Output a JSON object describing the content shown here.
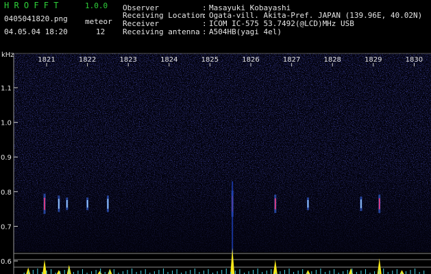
{
  "app": {
    "title": "H R O F F T",
    "version": "1.0.0"
  },
  "file_name": "0405041820.png",
  "meteor_label": "meteor",
  "meteor_count": "12",
  "date_time": "04.05.04 18:20",
  "info": [
    {
      "key": "Observer",
      "value": "Masayuki Kobayashi"
    },
    {
      "key": "Receiving Location",
      "value": "Ogata-vill. Akita-Pref. JAPAN (139.96E, 40.02N)"
    },
    {
      "key": "Receiver",
      "value": "ICOM IC-575 53.7492(@LCD)MHz USB"
    },
    {
      "key": "Receiving antenna",
      "value": "A504HB(yagi 4el)"
    }
  ],
  "separator": ":",
  "chart_data": {
    "type": "heatmap",
    "ylabel": "kHz",
    "x_ticks": [
      "1821",
      "1822",
      "1823",
      "1824",
      "1825",
      "1826",
      "1827",
      "1828",
      "1829",
      "1830"
    ],
    "y_ticks": [
      "1.1",
      "1.0",
      "0.9",
      "0.8",
      "0.7",
      "0.6"
    ],
    "xlim": [
      1820.5,
      1830.5
    ],
    "ylim": [
      0.58,
      1.18
    ],
    "meteor_echoes": [
      {
        "minute": 1820.95,
        "freq": 0.765,
        "strength": 0.7
      },
      {
        "minute": 1821.3,
        "freq": 0.765,
        "strength": 0.5
      },
      {
        "minute": 1821.5,
        "freq": 0.765,
        "strength": 0.3
      },
      {
        "minute": 1822.0,
        "freq": 0.765,
        "strength": 0.3
      },
      {
        "minute": 1822.5,
        "freq": 0.765,
        "strength": 0.5
      },
      {
        "minute": 1825.55,
        "freq": 0.765,
        "strength": 1.0
      },
      {
        "minute": 1826.6,
        "freq": 0.765,
        "strength": 0.6
      },
      {
        "minute": 1827.4,
        "freq": 0.765,
        "strength": 0.3
      },
      {
        "minute": 1828.7,
        "freq": 0.765,
        "strength": 0.4
      },
      {
        "minute": 1829.15,
        "freq": 0.765,
        "strength": 0.6
      }
    ],
    "bottom_peaks": [
      {
        "minute": 1820.55,
        "value": 0.25
      },
      {
        "minute": 1820.95,
        "value": 0.55
      },
      {
        "minute": 1821.3,
        "value": 0.15
      },
      {
        "minute": 1821.55,
        "value": 0.35
      },
      {
        "minute": 1822.3,
        "value": 0.12
      },
      {
        "minute": 1822.55,
        "value": 0.2
      },
      {
        "minute": 1825.55,
        "value": 1.0
      },
      {
        "minute": 1826.6,
        "value": 0.55
      },
      {
        "minute": 1827.4,
        "value": 0.15
      },
      {
        "minute": 1828.45,
        "value": 0.22
      },
      {
        "minute": 1829.15,
        "value": 0.6
      },
      {
        "minute": 1829.7,
        "value": 0.15
      }
    ]
  }
}
